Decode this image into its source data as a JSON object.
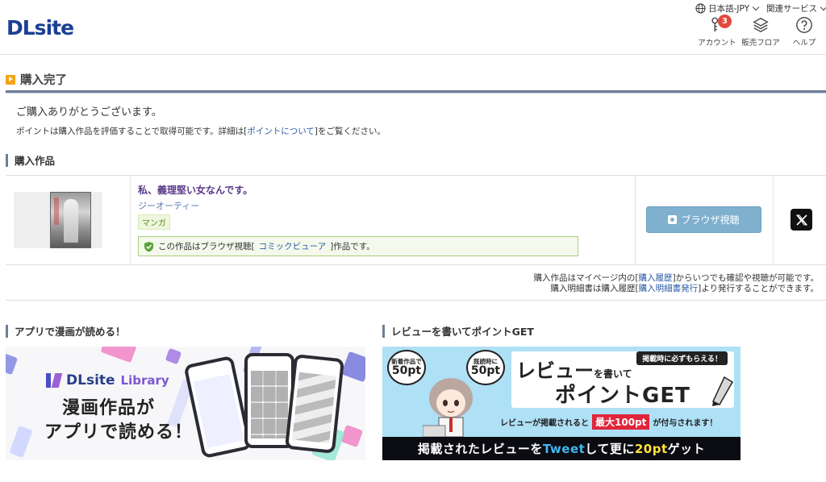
{
  "header": {
    "logo": "DLsite",
    "language": "日本語-JPY",
    "related_services": "関連サービス",
    "nav": [
      {
        "label": "アカウント",
        "icon": "account-icon",
        "badge": "3"
      },
      {
        "label": "販売フロア",
        "icon": "layers-icon"
      },
      {
        "label": "ヘルプ",
        "icon": "help-icon"
      }
    ]
  },
  "page": {
    "title": "購入完了",
    "thanks": "ご購入ありがとうございます。",
    "point_note": {
      "before": "ポイントは購入作品を評価することで取得可能です。詳細は[",
      "link": "ポイントについて",
      "after": "]をご覧ください。"
    }
  },
  "purchased": {
    "heading": "購入作品",
    "items": [
      {
        "title": "私、義理堅い女なんです。",
        "circle": "ジーオーティー",
        "genre": "マンガ",
        "notice_before": "この作品はブラウザ視聴[",
        "notice_link": "コミックビューア",
        "notice_after": "]作品です。",
        "browser_button": "ブラウザ視聴",
        "share_icon": "x-icon"
      }
    ],
    "note1": {
      "before": "購入作品はマイページ内の[",
      "link": "購入履歴",
      "after": "]からいつでも確認や視聴が可能です。"
    },
    "note2": {
      "before": "購入明細書は購入履歴[",
      "link": "購入明細書発行",
      "after": "]より発行することができます。"
    }
  },
  "app_section": {
    "heading": "アプリで漫画が読める！",
    "banner": {
      "logo_main": "DLsite",
      "logo_sub": "Library",
      "line1": "漫画作品が",
      "line2": "アプリで読める！"
    }
  },
  "review_section": {
    "heading": "レビューを書いてポイントGET",
    "banner": {
      "bubble1_small": "新着作品で",
      "bubble1_big": "50pt",
      "bubble2_small": "既読時に",
      "bubble2_big": "50pt",
      "tag": "掲載時に必ずもらえる！",
      "head1_main": "レビュー",
      "head1_small": "を書いて",
      "head2": "ポイントGET",
      "sub_before": "レビューが掲載されると",
      "sub_highlight": "最大100pt",
      "sub_after": "が付与されます！",
      "bottom_before": "掲載されたレビューを",
      "bottom_tweet": "Tweet",
      "bottom_mid": "して更に",
      "bottom_points": "20pt",
      "bottom_after": "ゲット"
    }
  },
  "colors": {
    "brand": "#1b3f93",
    "accent_orange": "#f5a218",
    "section_bar": "#6e7d98",
    "button_blue": "#7fb1cf",
    "work_title": "#5a3a8a"
  }
}
